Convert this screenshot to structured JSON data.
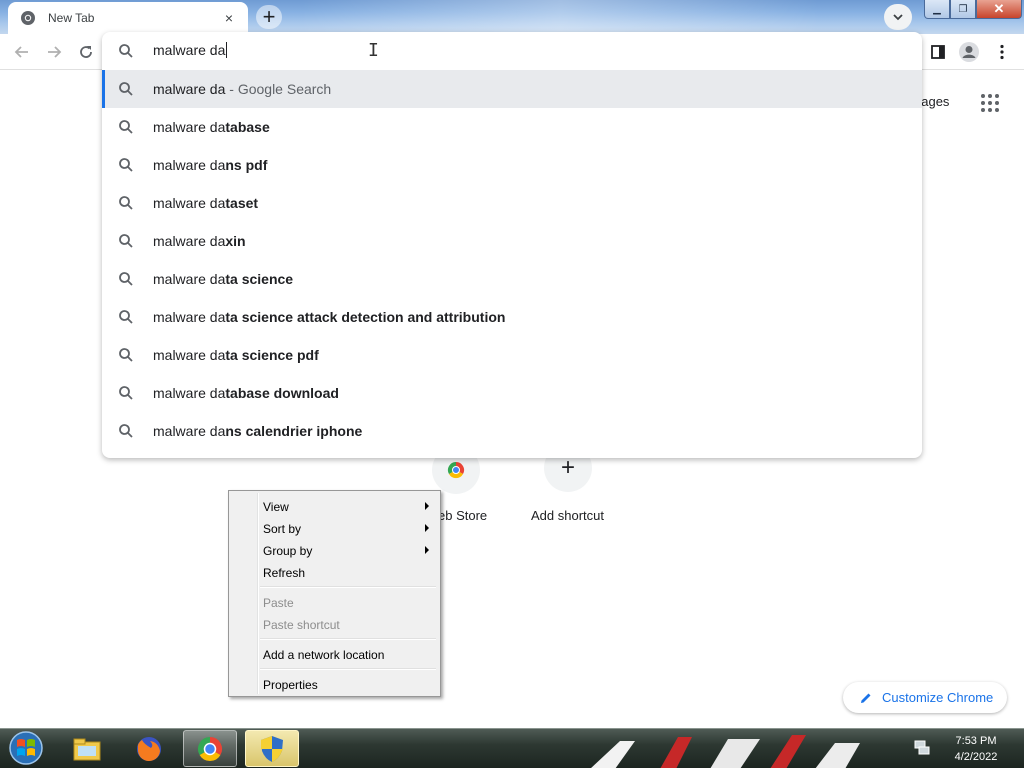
{
  "browser": {
    "tab": {
      "title": "New Tab",
      "close_glyph": "×"
    },
    "new_tab_glyph": "+",
    "window_controls": {
      "minimize": "▁",
      "restore": "❐",
      "close": "✕"
    }
  },
  "omnibox": {
    "value": "malware da",
    "suggestions": [
      {
        "typed": "malware da",
        "completion": "",
        "suffix": " - Google Search",
        "selected": true
      },
      {
        "typed": "malware da",
        "completion": "tabase",
        "suffix": ""
      },
      {
        "typed": "malware da",
        "completion": "ns pdf",
        "suffix": ""
      },
      {
        "typed": "malware da",
        "completion": "taset",
        "suffix": ""
      },
      {
        "typed": "malware da",
        "completion": "xin",
        "suffix": ""
      },
      {
        "typed": "malware da",
        "completion": "ta science",
        "suffix": ""
      },
      {
        "typed": "malware da",
        "completion": "ta science attack detection and attribution",
        "suffix": ""
      },
      {
        "typed": "malware da",
        "completion": "ta science pdf",
        "suffix": ""
      },
      {
        "typed": "malware da",
        "completion": "tabase download",
        "suffix": ""
      },
      {
        "typed": "malware da",
        "completion": "ns calendrier iphone",
        "suffix": ""
      }
    ]
  },
  "ntp": {
    "images_link": "nages",
    "shortcuts": [
      {
        "label": "eb Store",
        "icon": "chrome-web-store-icon"
      },
      {
        "label": "Add shortcut",
        "icon": "plus-icon",
        "glyph": "+"
      }
    ],
    "customize_label": "Customize Chrome"
  },
  "context_menu": {
    "items": [
      {
        "label": "View",
        "submenu": true,
        "enabled": true
      },
      {
        "label": "Sort by",
        "submenu": true,
        "enabled": true
      },
      {
        "label": "Group by",
        "submenu": true,
        "enabled": true
      },
      {
        "label": "Refresh",
        "submenu": false,
        "enabled": true
      },
      {
        "label": "Paste",
        "submenu": false,
        "enabled": false
      },
      {
        "label": "Paste shortcut",
        "submenu": false,
        "enabled": false
      },
      {
        "label": "Add a network location",
        "submenu": false,
        "enabled": true
      },
      {
        "label": "Properties",
        "submenu": false,
        "enabled": true
      }
    ]
  },
  "taskbar": {
    "apps": [
      "file-explorer-icon",
      "firefox-icon",
      "chrome-icon",
      "security-shield-icon"
    ],
    "clock": {
      "time": "7:53 PM",
      "date": "4/2/2022"
    }
  },
  "colors": {
    "accent": "#1a73e8",
    "selected_row": "#e8eaed"
  }
}
